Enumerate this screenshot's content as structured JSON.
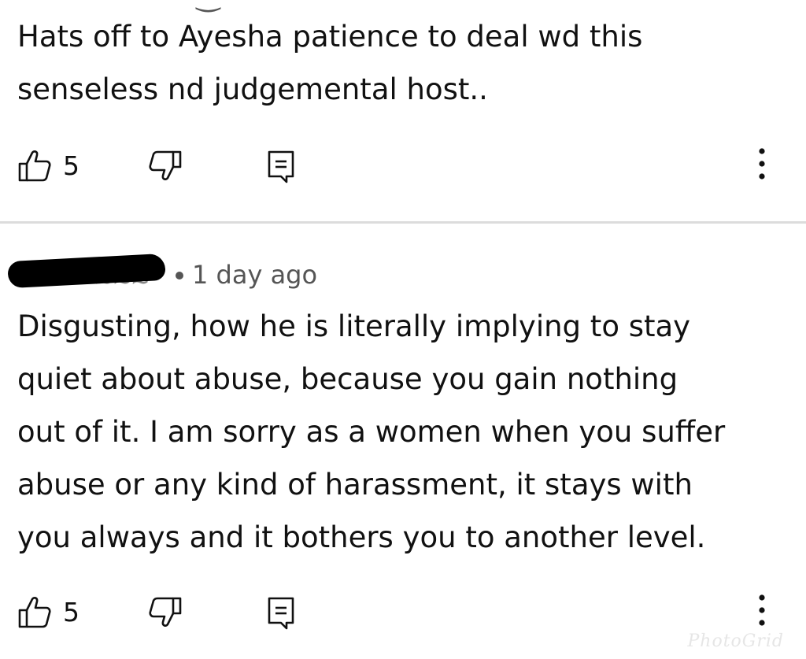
{
  "comments": [
    {
      "body": "Hats off to Ayesha patience to deal wd this\nsenseless nd judgemental host..",
      "likes": "5"
    },
    {
      "time": "1 day ago",
      "body": "Disgusting, how he is literally implying to stay\nquiet about abuse, because you gain nothing\nout of it. I am sorry as a women when you suffer\nabuse or any kind of harassment, it stays with\nyou always and it bothers you to another level.",
      "likes": "5"
    }
  ],
  "icons": {
    "like": "thumbs-up-icon",
    "dislike": "thumbs-down-icon",
    "reply": "comment-reply-icon",
    "more": "more-vertical-icon"
  },
  "watermark": "PhotoGrid",
  "colors": {
    "text": "#111111",
    "secondary_text": "#555555",
    "divider": "#dcdcdc",
    "redaction": "#000000"
  }
}
